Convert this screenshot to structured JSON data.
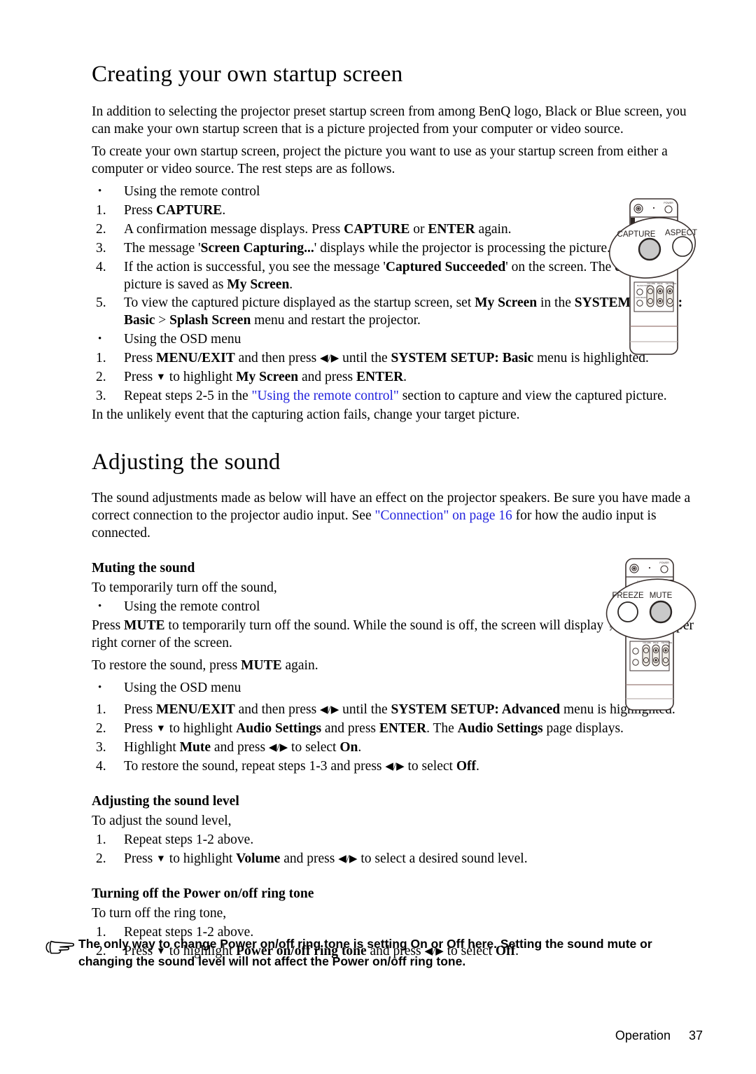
{
  "page": {
    "footer_section": "Operation",
    "footer_page_number": "37"
  },
  "sections": {
    "startup": {
      "heading": "Creating your own startup screen",
      "intro1": "In addition to selecting the projector preset startup screen from among BenQ logo, Black or Blue screen, you can make your own startup screen that is a picture projected from your computer or video source.",
      "intro2": "To create your own startup screen, project the picture you want to use as your startup screen from either a computer or video source. The rest steps are as follows.",
      "remote_bullet": "Using the remote control",
      "remote_steps": [
        {
          "n": "1."
        },
        {
          "n": "2."
        },
        {
          "n": "3."
        },
        {
          "n": "4."
        },
        {
          "n": "5."
        }
      ],
      "step1": {
        "pre": "Press ",
        "bold": "CAPTURE",
        "post": "."
      },
      "step2": {
        "pre": "A confirmation message displays. Press ",
        "bold1": "CAPTURE",
        "mid": " or ",
        "bold2": "ENTER",
        "post": " again."
      },
      "step3": {
        "pre": "The message '",
        "bold": "Screen Capturing...",
        "post": "' displays while the projector is processing the picture. Please wait."
      },
      "step4": {
        "pre": "If the action is successful, you see the message '",
        "bold1": "Captured Succeeded",
        "mid": "' on the screen. The captured picture is saved as ",
        "bold2": "My Screen",
        "post": "."
      },
      "step5": {
        "pre": "To view the captured picture displayed as the startup screen, set ",
        "bold1": "My Screen",
        "mid": " in the ",
        "bold2": "SYSTEM SETUP: Basic",
        "mid2": " > ",
        "bold3": "Splash Screen",
        "post": " menu and restart the projector."
      },
      "osd_bullet": "Using the OSD menu",
      "osd_steps": [
        {
          "n": "1."
        },
        {
          "n": "2."
        },
        {
          "n": "3."
        }
      ],
      "osd1": {
        "pre": "Press ",
        "bold1": "MENU/EXIT",
        "mid": " and then press ",
        "arrows": "◀/▶",
        "mid2": " until the ",
        "bold2": "SYSTEM SETUP: Basic",
        "post": " menu is highlighted."
      },
      "osd2": {
        "pre": "Press ",
        "arrow": "▼",
        "mid": " to highlight ",
        "bold1": "My Screen",
        "mid2": " and press ",
        "bold2": "ENTER",
        "post": "."
      },
      "osd3": {
        "pre": "Repeat steps 2-5 in the ",
        "link": "\"Using the remote control\"",
        "post": " section to capture and view the captured picture."
      },
      "closing": "In the unlikely event that the capturing action fails, change your target picture."
    },
    "sound": {
      "heading": "Adjusting the sound",
      "intro": {
        "pre": "The sound adjustments made as below will have an effect on the projector speakers. Be sure you have made a correct connection to the projector audio input. See ",
        "link": "\"Connection\" on page 16",
        "post": " for how the audio input is connected."
      },
      "muting": {
        "heading": "Muting the sound",
        "lead": "To temporarily turn off the sound,",
        "remote_bullet": "Using the remote control",
        "remote_text": {
          "pre": "Press ",
          "bold": "MUTE",
          "mid": " to temporarily turn off the sound. While the sound is off, the screen will display ",
          "icon": "mute-icon",
          "post": " in the upper right corner of the screen."
        },
        "restore_text": {
          "pre": "To restore the sound, press ",
          "bold": "MUTE",
          "post": " again."
        },
        "osd_bullet": "Using the OSD menu",
        "osd_steps": [
          {
            "n": "1."
          },
          {
            "n": "2."
          },
          {
            "n": "3."
          },
          {
            "n": "4."
          }
        ],
        "osd1": {
          "pre": "Press ",
          "bold1": "MENU/EXIT",
          "mid": " and then press ",
          "arrows": "◀/▶",
          "mid2": " until the ",
          "bold2": "SYSTEM SETUP: Advanced",
          "post": " menu is highlighted."
        },
        "osd2": {
          "pre": "Press ",
          "arrow": "▼",
          "mid": " to highlight ",
          "bold1": "Audio Settings",
          "mid2": " and press ",
          "bold2": "ENTER",
          "mid3": ". The ",
          "bold3": "Audio Settings",
          "post": " page displays."
        },
        "osd3": {
          "pre": "Highlight ",
          "bold1": "Mute",
          "mid": " and press ",
          "arrows": "◀/▶",
          "mid2": " to select ",
          "bold2": "On",
          "post": "."
        },
        "osd4": {
          "pre": "To restore the sound, repeat steps 1-3 and press ",
          "arrows": "◀/▶",
          "mid": " to select ",
          "bold": "Off",
          "post": "."
        }
      },
      "level": {
        "heading": "Adjusting the sound level",
        "lead": "To adjust the sound level,",
        "steps": [
          {
            "n": "1."
          },
          {
            "n": "2."
          }
        ],
        "s1": "Repeat steps 1-2 above.",
        "s2": {
          "pre": "Press ",
          "arrow": "▼",
          "mid": " to highlight ",
          "bold": "Volume",
          "mid2": " and press ",
          "arrows": "◀/▶",
          "post": " to select a desired sound level."
        }
      },
      "ringtone": {
        "heading": "Turning off the Power on/off ring tone",
        "lead": "To turn off the ring tone,",
        "steps": [
          {
            "n": "1."
          },
          {
            "n": "2."
          }
        ],
        "s1": "Repeat steps 1-2 above.",
        "s2": {
          "pre": "Press ",
          "arrow": "▼",
          "mid": " to highlight ",
          "bold1": "Power on/off ring tone",
          "mid2": " and press ",
          "arrows": "◀/▶",
          "mid3": " to select ",
          "bold2": "Off",
          "post": "."
        }
      }
    }
  },
  "note": {
    "text": "The only way to change Power on/off ring tone is setting On or Off here. Setting the sound mute or changing the sound level will not affect the Power on/off ring tone."
  },
  "illustrations": {
    "remote_capture": {
      "callout_label_left": "CAPTURE",
      "callout_label_right": "ASPECT",
      "body_label": "MENU"
    },
    "remote_mute": {
      "callout_label_left": "FREEZE",
      "callout_label_right": "MUTE"
    }
  },
  "colors": {
    "link": "#2222dd",
    "ink": "#000000",
    "button_fill": "#c9c9c9"
  }
}
